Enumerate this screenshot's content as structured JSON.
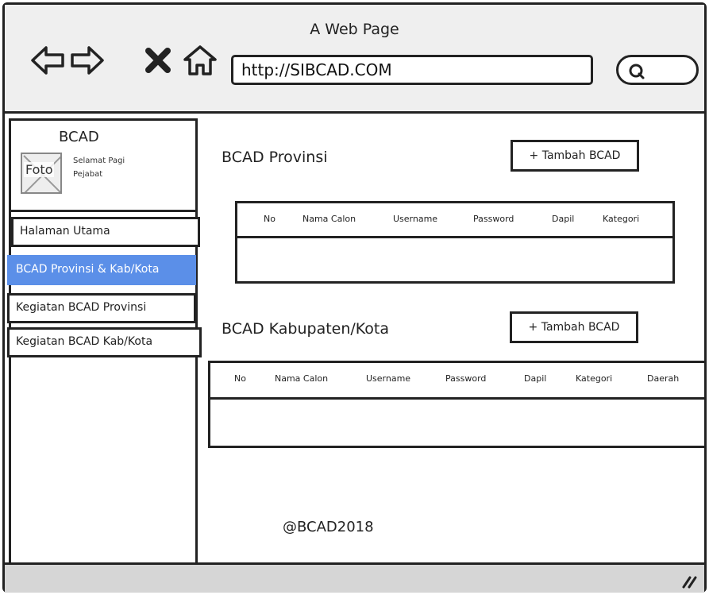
{
  "browser": {
    "window_title": "A Web Page",
    "url": "http://SIBCAD.COM",
    "icons": [
      "back-icon",
      "forward-icon",
      "close-icon",
      "home-icon",
      "search-icon"
    ]
  },
  "sidebar": {
    "brand": "BCAD",
    "photo_label": "Foto",
    "greeting_line1": "Selamat Pagi",
    "greeting_line2": "Pejabat",
    "items": [
      {
        "label": "Halaman Utama"
      },
      {
        "label": "BCAD Provinsi & Kab/Kota"
      },
      {
        "label": "Kegiatan BCAD Provinsi"
      },
      {
        "label": "Kegiatan BCAD Kab/Kota"
      }
    ]
  },
  "provinsi": {
    "heading": "BCAD Provinsi",
    "add_label": "+ Tambah BCAD",
    "columns": [
      "No",
      "Nama Calon",
      "Username",
      "Password",
      "Dapil",
      "Kategori"
    ]
  },
  "kabupaten": {
    "heading": "BCAD Kabupaten/Kota",
    "add_label": "+ Tambah BCAD",
    "columns": [
      "No",
      "Nama Calon",
      "Username",
      "Password",
      "Dapil",
      "Kategori",
      "Daerah"
    ]
  },
  "footer": {
    "text": "@BCAD2018"
  },
  "colors": {
    "active_menu": "#5b8fe8",
    "border": "#222222",
    "status_bar": "#d6d6d6"
  }
}
